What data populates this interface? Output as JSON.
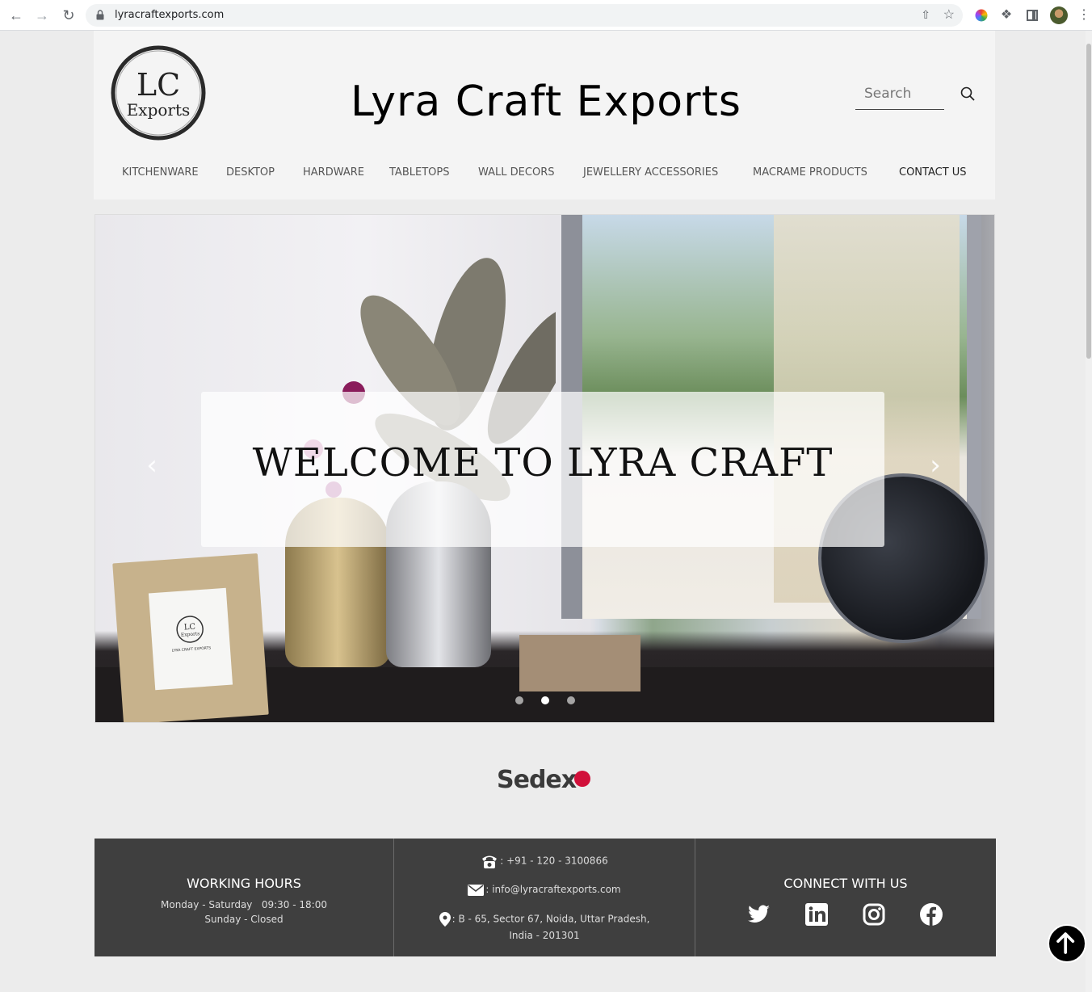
{
  "browser": {
    "url": "lyracraftexports.com"
  },
  "header": {
    "logo_line1": "LC",
    "logo_line2": "Exports",
    "site_title": "Lyra Craft Exports",
    "search_placeholder": "Search"
  },
  "nav": {
    "items": [
      {
        "label": "KITCHENWARE"
      },
      {
        "label": "DESKTOP"
      },
      {
        "label": "HARDWARE"
      },
      {
        "label": "TABLETOPS"
      },
      {
        "label": "WALL DECORS"
      },
      {
        "label": "JEWELLERY ACCESSORIES"
      },
      {
        "label": "MACRAME PRODUCTS"
      },
      {
        "label": "CONTACT US"
      }
    ]
  },
  "hero": {
    "banner_text": "WELCOME  TO LYRA CRAFT",
    "frame_logo_line1": "LC",
    "frame_logo_line2": "Exports",
    "frame_caption": "LYRA CRAFT EXPORTS",
    "slide_count": 3,
    "active_slide": 2
  },
  "certification": {
    "logo_text": "Sedex",
    "brand_color": "#d1103a"
  },
  "footer": {
    "working_hours_title": "WORKING HOURS",
    "hours_line1": "Monday - Saturday   09:30 - 18:00",
    "hours_line2": "Sunday - Closed",
    "phone": ": +91 - 120 - 3100866",
    "email": ": info@lyracraftexports.com",
    "address_line1": ": B - 65, Sector 67, Noida, Uttar Pradesh,",
    "address_line2": "India - 201301",
    "connect_title": "CONNECT WITH US",
    "social": [
      "twitter-icon",
      "linkedin-icon",
      "instagram-icon",
      "facebook-icon"
    ]
  }
}
